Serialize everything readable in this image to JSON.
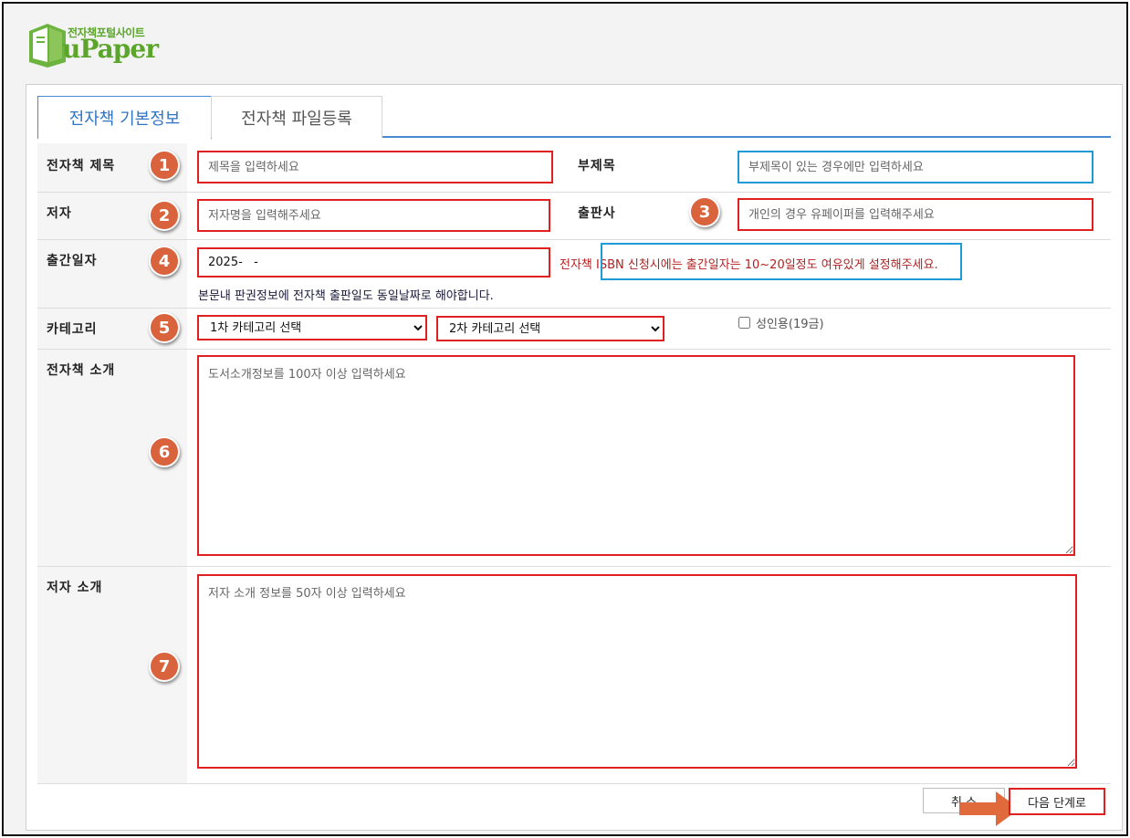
{
  "logo": {
    "tagline": "전자책포털사이트",
    "brand": "uPaper"
  },
  "tabs": [
    {
      "label": "전자책 기본정보",
      "active": true
    },
    {
      "label": "전자책 파일등록",
      "active": false
    }
  ],
  "badges": [
    "1",
    "2",
    "3",
    "4",
    "5",
    "6",
    "7"
  ],
  "fields": {
    "title": {
      "label": "전자책 제목",
      "placeholder": "제목을 입력하세요"
    },
    "subtitle": {
      "label": "부제목",
      "placeholder": "부제목이 있는 경우에만 입력하세요"
    },
    "author": {
      "label": "저자",
      "placeholder": "저자명을 입력해주세요"
    },
    "publisher": {
      "label": "출판사",
      "placeholder": "개인의 경우 유페이퍼를 입력해주세요"
    },
    "pubdate": {
      "label": "출간일자",
      "value": "2025-   -",
      "notice_prefix": "전자책 ",
      "notice_highlight": "ISBN 신청시에는 출간일자는 10~20일정도 여유있게 설정",
      "notice_suffix": "해주세요.",
      "notice2": "본문내 판권정보에 전자책 출판일도 동일날짜로 해야합니다."
    },
    "category": {
      "label": "카테고리",
      "primary": "1차 카테고리 선택",
      "secondary": "2차 카테고리 선택",
      "adult_label": "성인용(19금)",
      "adult_checked": false
    },
    "intro": {
      "label": "전자책 소개",
      "placeholder": "도서소개정보를 100자 이상 입력하세요"
    },
    "author_intro": {
      "label": "저자 소개",
      "placeholder": "저자 소개 정보를 50자 이상 입력하세요"
    }
  },
  "buttons": {
    "prev": "취 소",
    "next": "다음 단계로"
  },
  "colors": {
    "accent": "#2f74c6",
    "highlight_red": "#e02020",
    "highlight_blue": "#1e9bd7",
    "badge": "#d9633d",
    "brand_green": "#5aa52a"
  }
}
